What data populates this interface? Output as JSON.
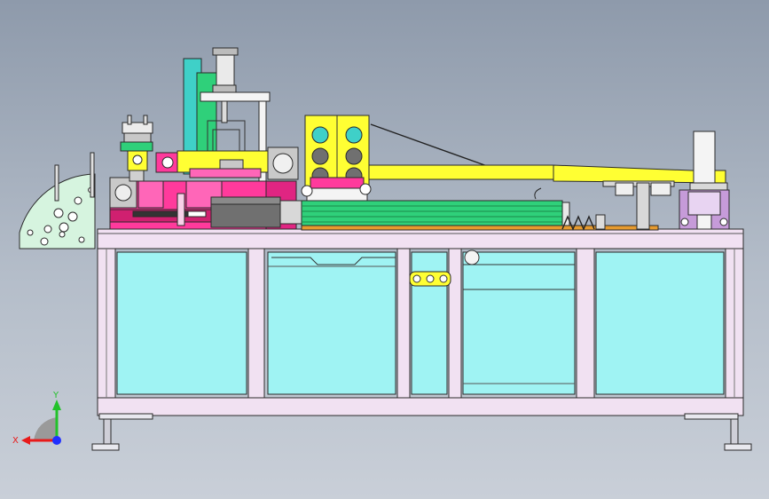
{
  "viewport": {
    "background_top": "#8e9aab",
    "background_bottom": "#c9cfd8"
  },
  "triad": {
    "x_label": "X",
    "y_label": "Y",
    "x_color": "#e81a1a",
    "y_color": "#22c22a",
    "z_color": "#2030ff"
  },
  "colors": {
    "frame": "#f1e1f2",
    "frame_edge": "#2a2a2a",
    "panel": "#9ff3f3",
    "magenta": "#ff3a9c",
    "yellow": "#ffff33",
    "green": "#2fd07a",
    "cyan_bar": "#3fd0c8",
    "orange": "#e69a2e",
    "pale_green": "#d6f4df",
    "dark_gray": "#707070",
    "light_gray": "#d8d8d8",
    "violet": "#c69bd9"
  }
}
